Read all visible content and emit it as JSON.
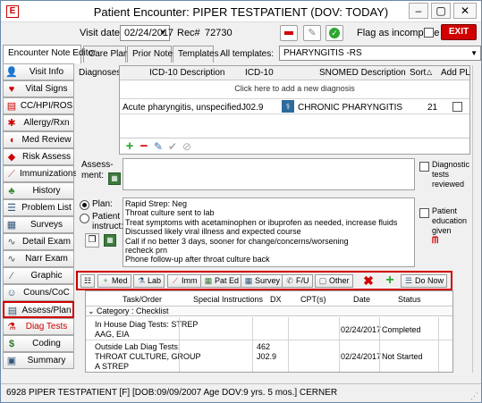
{
  "window": {
    "title": "Patient Encounter: PIPER TESTPATIENT (DOV: TODAY)",
    "app_icon": "E"
  },
  "toprow": {
    "visit_date_label": "Visit date:",
    "visit_date": "02/24/2017",
    "rec_label": "Rec#",
    "rec_value": "72730",
    "flag_incomplete_label": "Flag as incomplete",
    "exit_label": "EXIT"
  },
  "tabs": [
    "Encounter Note Editor",
    "Care Plans",
    "Prior Notes",
    "Templates"
  ],
  "templates": {
    "label": "All templates:",
    "selected": "PHARYNGITIS -RS"
  },
  "sidebar": [
    {
      "label": "Visit Info",
      "icon": "person-icon"
    },
    {
      "label": "Vital Signs",
      "icon": "pulse-icon"
    },
    {
      "label": "CC/HPI/ROS",
      "icon": "clipboard-icon"
    },
    {
      "label": "Allergy/Rxn",
      "icon": "allergy-icon"
    },
    {
      "label": "Med Review",
      "icon": "pill-icon"
    },
    {
      "label": "Risk Assess",
      "icon": "risk-icon"
    },
    {
      "label": "Immunizations",
      "icon": "syringe-icon"
    },
    {
      "label": "History",
      "icon": "tree-icon"
    },
    {
      "label": "Problem List",
      "icon": "list-icon"
    },
    {
      "label": "Surveys",
      "icon": "survey-icon"
    },
    {
      "label": "Detail Exam",
      "icon": "stethoscope-icon"
    },
    {
      "label": "Narr Exam",
      "icon": "stethoscope-icon"
    },
    {
      "label": "Graphic",
      "icon": "graphic-icon"
    },
    {
      "label": "Couns/CoC",
      "icon": "counsel-icon"
    },
    {
      "label": "Assess/Plan",
      "icon": "assess-icon"
    },
    {
      "label": "Diag Tests",
      "icon": "diagtest-icon"
    },
    {
      "label": "Coding",
      "icon": "dollar-icon"
    },
    {
      "label": "Summary",
      "icon": "summary-icon"
    }
  ],
  "diagnoses": {
    "label": "Diagnoses:",
    "columns": [
      "ICD-10 Description",
      "ICD-10",
      "SNOMED Description",
      "Sort",
      "Add PL"
    ],
    "add_prompt": "Click here to add a new diagnosis",
    "rows": [
      {
        "icd_desc": "Acute pharyngitis, unspecified",
        "icd": "J02.9",
        "snomed": "CHRONIC PHARYNGITIS",
        "sort": "21"
      }
    ]
  },
  "assessment": {
    "label": "Assess-\nment:",
    "diag_reviewed_label": "Diagnostic tests reviewed"
  },
  "plan": {
    "plan_radio": "Plan:",
    "instruct_radio": "Patient instruct:",
    "lines": [
      "Rapid Strep: Neg",
      "Throat culture sent to lab",
      "Treat symptoms with acetaminophen or ibuprofen as needed, increase fluids",
      "Discussed likely viral illness and expected course",
      "Call if no better 3 days, sooner for change/concerns/worsening",
      "recheck prn",
      "Phone follow-up after throat culture back"
    ],
    "education_label": "Patient education given"
  },
  "order_toolbar": {
    "buttons": [
      "Med",
      "Lab",
      "Imm",
      "Pat Ed",
      "Survey",
      "F/U",
      "Other"
    ],
    "donow_label": "Do Now"
  },
  "orders": {
    "columns": [
      "Task/Order",
      "Special Instructions",
      "DX",
      "CPT(s)",
      "Date",
      "Status"
    ],
    "category": "Category : Checklist",
    "rows": [
      {
        "task": "In House Diag Tests: STREP\nAAG, EIA",
        "dx": "",
        "date": "02/24/2017",
        "status": "Completed"
      },
      {
        "task": "Outside Lab Diag Tests:\nTHROAT CULTURE, GROUP\nA STREP",
        "dx": "462\nJ02.9",
        "date": "02/24/2017",
        "status": "Not Started"
      }
    ]
  },
  "statusbar": {
    "text": "6928 PIPER TESTPATIENT [F] [DOB:09/09/2007  Age DOV:9 yrs. 5 mos.] CERNER"
  },
  "colors": {
    "accent_red": "#d00000",
    "selection_highlight": "#d00000"
  }
}
